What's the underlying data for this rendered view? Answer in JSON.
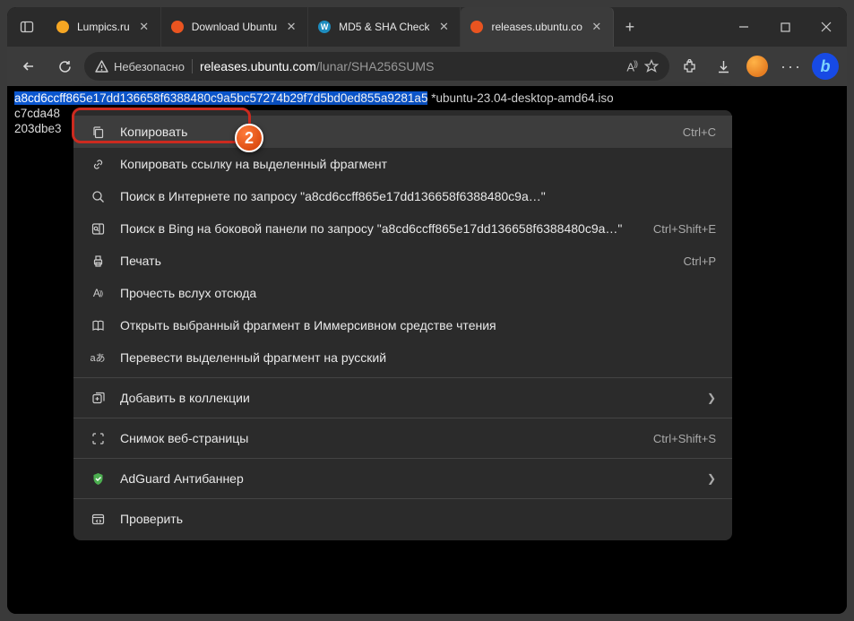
{
  "tabs": [
    {
      "label": "Lumpics.ru",
      "fav_color": "#f5a623"
    },
    {
      "label": "Download Ubuntu",
      "fav_color": "#E95420"
    },
    {
      "label": "MD5 & SHA Check",
      "fav_color": "#1e8cbe"
    },
    {
      "label": "releases.ubuntu.co",
      "fav_color": "#E95420"
    }
  ],
  "toolbar": {
    "insecure_label": "Небезопасно",
    "url_host": "releases.ubuntu.com",
    "url_path": "/lunar/SHA256SUMS"
  },
  "page": {
    "line1_hash": "a8cd6ccff865e17dd136658f6388480c9a5bc57274b29f7d5bd0ed855a9281a5",
    "line1_file": " *ubuntu-23.04-desktop-amd64.iso",
    "line2": "c7cda48",
    "line3": "203dbe3"
  },
  "ctx": {
    "copy": "Копировать",
    "copy_sc": "Ctrl+C",
    "copy_link": "Копировать ссылку на выделенный фрагмент",
    "search_web": "Поиск в Интернете по запросу \"a8cd6ccff865e17dd136658f6388480c9a…\"",
    "search_bing": "Поиск в Bing на боковой панели по запросу \"a8cd6ccff865e17dd136658f6388480c9a…\"",
    "search_bing_sc": "Ctrl+Shift+E",
    "print": "Печать",
    "print_sc": "Ctrl+P",
    "read_aloud": "Прочесть вслух отсюда",
    "immersive": "Открыть выбранный фрагмент в Иммерсивном средстве чтения",
    "translate": "Перевести выделенный фрагмент на русский",
    "collections": "Добавить в коллекции",
    "webcapture": "Снимок веб-страницы",
    "webcapture_sc": "Ctrl+Shift+S",
    "adguard": "AdGuard Антибаннер",
    "inspect": "Проверить"
  },
  "badge": "2"
}
